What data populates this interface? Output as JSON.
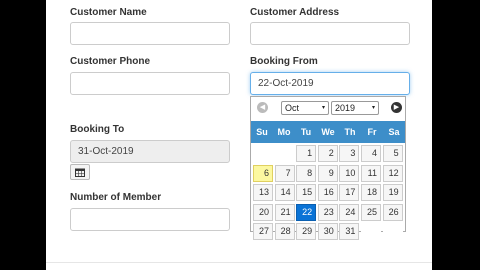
{
  "form": {
    "customer_name_label": "Customer Name",
    "customer_name_value": "",
    "customer_address_label": "Customer Address",
    "customer_address_value": "",
    "customer_phone_label": "Customer Phone",
    "customer_phone_value": "",
    "booking_from_label": "Booking From",
    "booking_from_value": "22-Oct-2019",
    "booking_to_label": "Booking To",
    "booking_to_value": "31-Oct-2019",
    "members_label": "Number of Member",
    "members_value": ""
  },
  "datepicker": {
    "month": "Oct",
    "year": "2019",
    "prev_icon": "chevron-left-circle-icon",
    "next_icon": "chevron-right-circle-icon",
    "prev_glyph": "◀",
    "next_glyph": "▶",
    "dropdown_glyph": "▾",
    "weekdays": [
      "Su",
      "Mo",
      "Tu",
      "We",
      "Th",
      "Fr",
      "Sa"
    ],
    "weeks": [
      [
        "",
        "",
        "1",
        "2",
        "3",
        "4",
        "5"
      ],
      [
        "6",
        "7",
        "8",
        "9",
        "10",
        "11",
        "12"
      ],
      [
        "13",
        "14",
        "15",
        "16",
        "17",
        "18",
        "19"
      ],
      [
        "20",
        "21",
        "22",
        "23",
        "24",
        "25",
        "26"
      ],
      [
        "27",
        "28",
        "29",
        "30",
        "31",
        "",
        ""
      ]
    ],
    "today": "6",
    "selected": "22",
    "header_color": "#3d8ec9",
    "selected_color": "#0a73d6",
    "today_color": "#fcf8a0"
  },
  "calendar_button_icon": "calendar-icon"
}
